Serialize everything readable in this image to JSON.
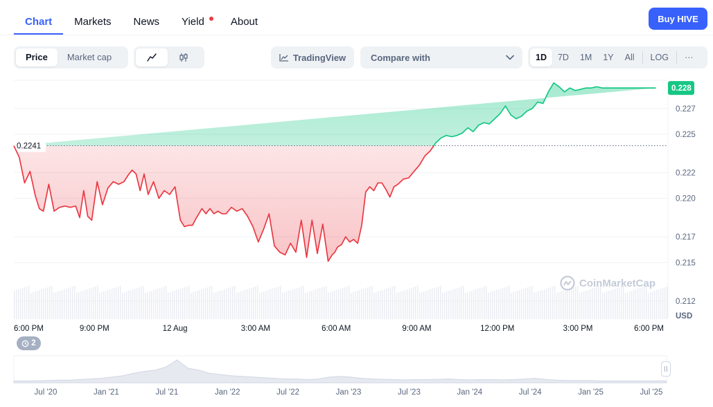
{
  "tabs": [
    {
      "label": "Chart",
      "active": true
    },
    {
      "label": "Markets"
    },
    {
      "label": "News"
    },
    {
      "label": "Yield",
      "dot": true
    },
    {
      "label": "About"
    }
  ],
  "buy_button": "Buy HIVE",
  "toolbar": {
    "price": "Price",
    "market_cap": "Market cap",
    "line_icon": "line-chart-icon",
    "candle_icon": "candlestick-icon",
    "tradingview": "TradingView",
    "compare_placeholder": "Compare with",
    "ranges": [
      "1D",
      "7D",
      "1M",
      "1Y",
      "All"
    ],
    "active_range": "1D",
    "log": "LOG",
    "more": "···"
  },
  "colors": {
    "accent": "#3861fb",
    "up": "#16c784",
    "down": "#ea3943",
    "up_label_bg": "#16c784"
  },
  "watermark": "CoinMarketCap",
  "events_badge": "2",
  "chart_data": [
    {
      "type": "area",
      "currency_label": "USD",
      "baseline": 0.2241,
      "baseline_label": "0.2241",
      "current_price_label": "0.228",
      "yticks": [
        "0.227",
        "0.225",
        "0.222",
        "0.220",
        "0.217",
        "0.215",
        "0.212"
      ],
      "ytick_values": [
        0.227,
        0.225,
        0.222,
        0.22,
        0.217,
        0.215,
        0.212
      ],
      "xticks": [
        "6:00 PM",
        "9:00 PM",
        "12 Aug",
        "3:00 AM",
        "6:00 AM",
        "9:00 AM",
        "12:00 PM",
        "3:00 PM",
        "6:00 PM"
      ],
      "ylim": [
        0.2107,
        0.2292
      ],
      "x": [
        0.0,
        0.2,
        0.4,
        0.6,
        0.8,
        0.95,
        1.1,
        1.3,
        1.5,
        1.7,
        1.9,
        2.1,
        2.3,
        2.45,
        2.6,
        2.75,
        2.9,
        3.1,
        3.3,
        3.5,
        3.7,
        3.9,
        4.1,
        4.25,
        4.4,
        4.55,
        4.7,
        4.85,
        5.0,
        5.2,
        5.4,
        5.6,
        5.8,
        6.0,
        6.2,
        6.35,
        6.5,
        6.65,
        6.8,
        7.0,
        7.15,
        7.3,
        7.45,
        7.6,
        7.75,
        7.9,
        8.1,
        8.3,
        8.5,
        8.7,
        8.9,
        9.1,
        9.3,
        9.5,
        9.7,
        9.9,
        10.1,
        10.3,
        10.5,
        10.7,
        10.9,
        11.1,
        11.3,
        11.5,
        11.7,
        11.85,
        11.95,
        12.05,
        12.2,
        12.35,
        12.5,
        12.65,
        12.8,
        12.95,
        13.1,
        13.25,
        13.4,
        13.55,
        13.7,
        13.85,
        14.0,
        14.15,
        14.3,
        14.5,
        14.7,
        14.9,
        15.1,
        15.3,
        15.5,
        15.7,
        15.9,
        16.1,
        16.3,
        16.5,
        16.7,
        16.9,
        17.1,
        17.3,
        17.5,
        17.7,
        17.9,
        18.1,
        18.3,
        18.5,
        18.7,
        18.9,
        19.1,
        19.3,
        19.5,
        19.7,
        19.9,
        20.1,
        20.3,
        20.5,
        20.7,
        20.9,
        21.1,
        21.3,
        21.5,
        21.7,
        21.9,
        22.1,
        22.3,
        22.5,
        22.7,
        22.9,
        23.1,
        23.3,
        23.5,
        23.7,
        23.9,
        24.1,
        24.3
      ],
      "y": [
        0.2241,
        0.2232,
        0.2212,
        0.2221,
        0.2202,
        0.2192,
        0.219,
        0.2211,
        0.219,
        0.2193,
        0.2194,
        0.2193,
        0.2194,
        0.2185,
        0.2206,
        0.2186,
        0.2183,
        0.2213,
        0.2195,
        0.2208,
        0.2213,
        0.2211,
        0.2213,
        0.2218,
        0.2222,
        0.2219,
        0.2206,
        0.2219,
        0.2203,
        0.2213,
        0.22,
        0.2206,
        0.2203,
        0.2209,
        0.2183,
        0.2178,
        0.2179,
        0.2179,
        0.2185,
        0.2192,
        0.2188,
        0.2192,
        0.2188,
        0.219,
        0.2188,
        0.2188,
        0.2193,
        0.219,
        0.2192,
        0.2186,
        0.2178,
        0.2166,
        0.2176,
        0.2188,
        0.2163,
        0.2158,
        0.2156,
        0.2165,
        0.2158,
        0.2183,
        0.2154,
        0.2183,
        0.2157,
        0.218,
        0.2151,
        0.2156,
        0.2158,
        0.2162,
        0.2164,
        0.217,
        0.2166,
        0.2168,
        0.2165,
        0.2179,
        0.2205,
        0.2209,
        0.2206,
        0.2212,
        0.2212,
        0.2207,
        0.2201,
        0.2209,
        0.2211,
        0.2215,
        0.2216,
        0.2221,
        0.2226,
        0.2233,
        0.2237,
        0.2243,
        0.2247,
        0.2249,
        0.2248,
        0.2249,
        0.2251,
        0.2255,
        0.2252,
        0.2257,
        0.2259,
        0.2258,
        0.2262,
        0.2266,
        0.2272,
        0.2265,
        0.2262,
        0.2264,
        0.2268,
        0.227,
        0.2275,
        0.2274,
        0.2283,
        0.229,
        0.2287,
        0.2283,
        0.2286,
        0.2284,
        0.2285,
        0.2286,
        0.2286,
        0.2287,
        0.2286,
        0.2286,
        0.2286,
        0.2286,
        0.2286,
        0.2286,
        0.2286,
        0.2286,
        0.2286,
        0.2286,
        0.2286
      ]
    },
    {
      "type": "area",
      "xticks": [
        "Jul '20",
        "Jan '21",
        "Jul '21",
        "Jan '22",
        "Jul '22",
        "Jan '23",
        "Jul '23",
        "Jan '24",
        "Jul '24",
        "Jan '25",
        "Jul '25"
      ],
      "values": [
        0.3,
        0.3,
        0.3,
        0.35,
        0.4,
        0.4,
        0.5,
        0.6,
        0.7,
        0.9,
        1.1,
        1.5,
        1.8,
        2.0,
        2.5,
        3.6,
        2.3,
        2.0,
        1.5,
        1.3,
        1.1,
        1.0,
        0.9,
        0.8,
        0.7,
        0.6,
        0.6,
        0.5,
        0.6,
        0.9,
        1.0,
        0.9,
        0.7,
        0.6,
        0.55,
        0.5,
        0.45,
        0.5,
        0.5,
        0.55,
        0.6,
        0.5,
        0.45,
        0.5,
        0.5,
        0.45,
        0.5,
        0.6,
        0.7,
        0.5,
        0.4,
        0.35,
        0.35,
        0.35,
        0.3,
        0.3,
        0.3,
        0.3,
        0.3,
        0.3,
        0.3
      ]
    }
  ]
}
